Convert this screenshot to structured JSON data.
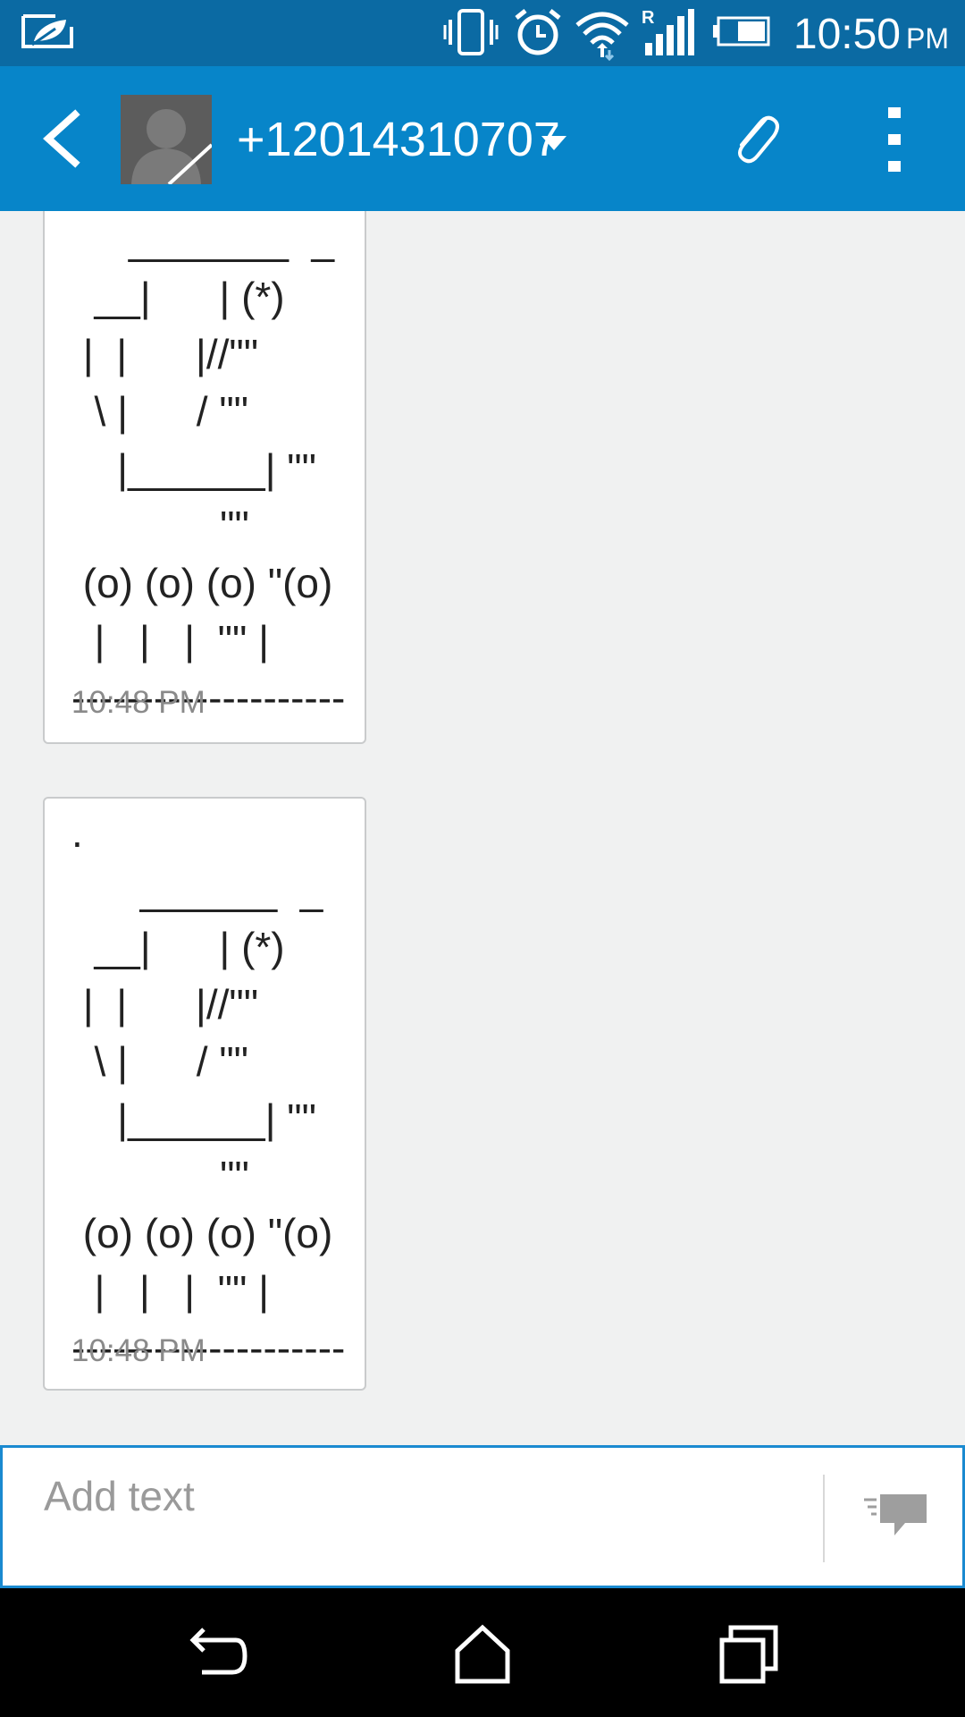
{
  "status_bar": {
    "time": "10:50",
    "ampm": "PM",
    "icons": [
      "leaf-icon",
      "vibrate-icon",
      "alarm-icon",
      "wifi-icon",
      "roaming-signal-icon",
      "battery-icon"
    ]
  },
  "header": {
    "contact": "+12014310707",
    "icons": [
      "back-icon",
      "avatar",
      "dropdown-caret-icon",
      "paperclip-icon",
      "overflow-menu-icon"
    ]
  },
  "messages": [
    {
      "text": "     _______  _\n  __|      | (*)\n |  |      |//\"\"\n  \\ |      / \"\"\n    |______| \"\"\n             \"\"\n (o) (o) (o) \"(o)\n  |   |   |  \"\" |\n--------------------",
      "time": "10:48 PM"
    },
    {
      "text": ".\n      ______  _\n  __|      | (*)\n |  |      |//\"\"\n  \\ |      / \"\"\n    |______| \"\"\n             \"\"\n (o) (o) (o) \"(o)\n  |   |   |  \"\" |\n--------------------",
      "time": "10:48 PM"
    }
  ],
  "compose": {
    "placeholder": "Add text",
    "value": ""
  },
  "colors": {
    "status_bar": "#0b6aa3",
    "app_bar": "#0785c9",
    "background": "#f0f1f1",
    "compose_border": "#1a8ad0"
  }
}
